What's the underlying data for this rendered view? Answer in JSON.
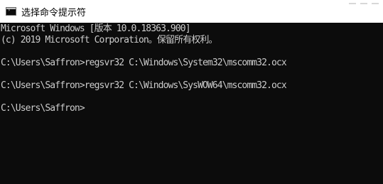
{
  "window": {
    "title": "选择命令提示符",
    "icon": "cmd-icon"
  },
  "console": {
    "lines": [
      "Microsoft Windows [版本 10.0.18363.900]",
      "(c) 2019 Microsoft Corporation。保留所有权利。",
      "",
      "C:\\Users\\Saffron>regsvr32 C:\\Windows\\System32\\mscomm32.ocx",
      "",
      "C:\\Users\\Saffron>regsvr32 C:\\Windows\\SysWOW64\\mscomm32.ocx",
      "",
      "C:\\Users\\Saffron>"
    ]
  },
  "colors": {
    "console_background": "#0c0c0c",
    "console_text": "#cccccc",
    "titlebar_background": "#ffffff"
  }
}
